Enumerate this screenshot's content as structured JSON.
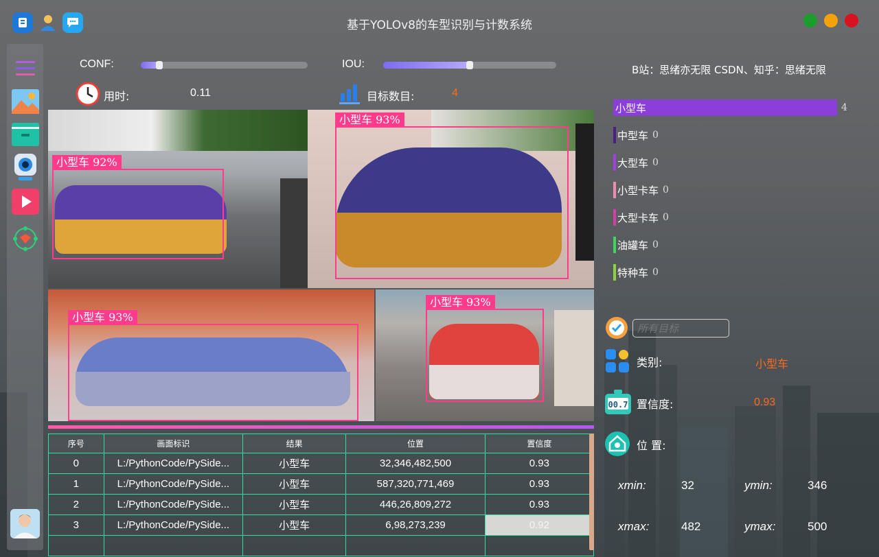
{
  "window": {
    "title": "基于YOLOv8的车型识别与计数系统",
    "controls": {
      "minimize_color": "#1a9d2a",
      "maximize_color": "#f5a10a",
      "close_color": "#d8121f"
    }
  },
  "toolbar": {
    "conf_label": "CONF:",
    "conf_value": 0.11,
    "iou_label": "IOU:",
    "iou_value": 0.5,
    "time_label": "用时:",
    "time_value": "0.11",
    "count_label": "目标数目:",
    "count_value": "4"
  },
  "credits": "B站：思绪亦无限  CSDN、知乎：思绪无限",
  "detections": [
    {
      "label": "小型车  92%"
    },
    {
      "label": "小型车  93%"
    },
    {
      "label": "小型车  93%"
    },
    {
      "label": "小型车  93%"
    }
  ],
  "table": {
    "headers": [
      "序号",
      "画面标识",
      "结果",
      "位置",
      "置信度"
    ],
    "rows": [
      [
        "0",
        "L:/PythonCode/PySide...",
        "小型车",
        "32,346,482,500",
        "0.93"
      ],
      [
        "1",
        "L:/PythonCode/PySide...",
        "小型车",
        "587,320,771,469",
        "0.93"
      ],
      [
        "2",
        "L:/PythonCode/PySide...",
        "小型车",
        "446,26,809,272",
        "0.93"
      ],
      [
        "3",
        "L:/PythonCode/PySide...",
        "小型车",
        "6,98,273,239",
        "0.92"
      ]
    ]
  },
  "classes": [
    {
      "name": "小型车",
      "count": "4",
      "color": "#8b3fd9"
    },
    {
      "name": "中型车",
      "count": "0",
      "color": "#4a1f88"
    },
    {
      "name": "大型车",
      "count": "0",
      "color": "#a23fe0"
    },
    {
      "name": "小型卡车",
      "count": "0",
      "color": "#f08ab0"
    },
    {
      "name": "大型卡车",
      "count": "0",
      "color": "#d23fa8"
    },
    {
      "name": "油罐车",
      "count": "0",
      "color": "#3fd45a"
    },
    {
      "name": "特种车",
      "count": "0",
      "color": "#8bd43f"
    }
  ],
  "filter": {
    "placeholder": "所有目标"
  },
  "detail": {
    "category_label": "类别:",
    "category_value": "小型车",
    "confidence_label": "置信度:",
    "confidence_value": "0.93",
    "position_label": "位 置:",
    "xmin_label": "xmin:",
    "xmin_value": "32",
    "ymin_label": "ymin:",
    "ymin_value": "346",
    "xmax_label": "xmax:",
    "xmax_value": "482",
    "ymax_label": "ymax:",
    "ymax_value": "500"
  },
  "accent_colors": {
    "value_orange": "#ff6a1a",
    "table_border": "#2fe0a5"
  }
}
